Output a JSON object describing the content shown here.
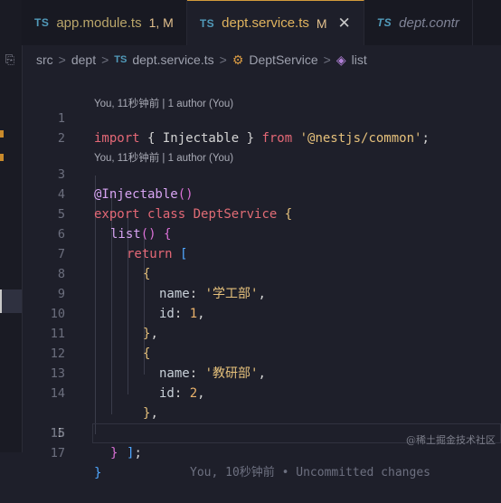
{
  "tabs": [
    {
      "icon": "TS",
      "label": "app.module.ts",
      "status": "1, M",
      "state": "modified"
    },
    {
      "icon": "TS",
      "label": "dept.service.ts",
      "status": "M",
      "state": "active"
    },
    {
      "icon": "TS",
      "label": "dept.contr",
      "status": "",
      "state": "inactive"
    }
  ],
  "breadcrumb": {
    "src": "src",
    "dept": "dept",
    "file_icon": "TS",
    "file": "dept.service.ts",
    "class": "DeptService",
    "method": "list",
    "separator": ">"
  },
  "blame": {
    "top": "You, 11秒钟前 | 1 author (You)",
    "middle": "You, 11秒钟前 | 1 author (You)",
    "inline": "You, 10秒钟前 • Uncommitted changes"
  },
  "lines": {
    "l1": {
      "n": "1",
      "t1": "import",
      "t2": " { Injectable } ",
      "t3": "from",
      "t4": " ",
      "t5": "'@nestjs/common'",
      "t6": ";"
    },
    "l2": {
      "n": "2"
    },
    "l3": {
      "n": "3",
      "t1": "@Injectable",
      "t2": "()"
    },
    "l4": {
      "n": "4",
      "t1": "export",
      "t2": " ",
      "t3": "class",
      "t4": " ",
      "t5": "DeptService",
      "t6": " {"
    },
    "l5": {
      "n": "5",
      "t1": "list",
      "t2": "() ",
      "t3": "{"
    },
    "l6": {
      "n": "6",
      "t1": "return",
      "t2": " ["
    },
    "l7": {
      "n": "7",
      "t1": "{"
    },
    "l8": {
      "n": "8",
      "t1": "name",
      "t2": ": ",
      "t3": "'学工部'",
      "t4": ","
    },
    "l9": {
      "n": "9",
      "t1": "id",
      "t2": ": ",
      "t3": "1",
      "t4": ","
    },
    "l10": {
      "n": "10",
      "t1": "}",
      "t2": ","
    },
    "l11": {
      "n": "11",
      "t1": "{"
    },
    "l12": {
      "n": "12",
      "t1": "name",
      "t2": ": ",
      "t3": "'教研部'",
      "t4": ","
    },
    "l13": {
      "n": "13",
      "t1": "id",
      "t2": ": ",
      "t3": "2",
      "t4": ","
    },
    "l14": {
      "n": "14",
      "t1": "}",
      "t2": ","
    },
    "l15": {
      "n": "15",
      "t1": "]",
      "t2": ";"
    },
    "l16": {
      "n": "16",
      "t1": "}"
    },
    "l17": {
      "n": "17",
      "t1": "}"
    }
  },
  "watermark": "@稀土掘金技术社区",
  "colors": {
    "accent": "#d39b3b",
    "keyword": "#e46876",
    "string": "#e5c07b",
    "ts_icon": "#519aba"
  }
}
